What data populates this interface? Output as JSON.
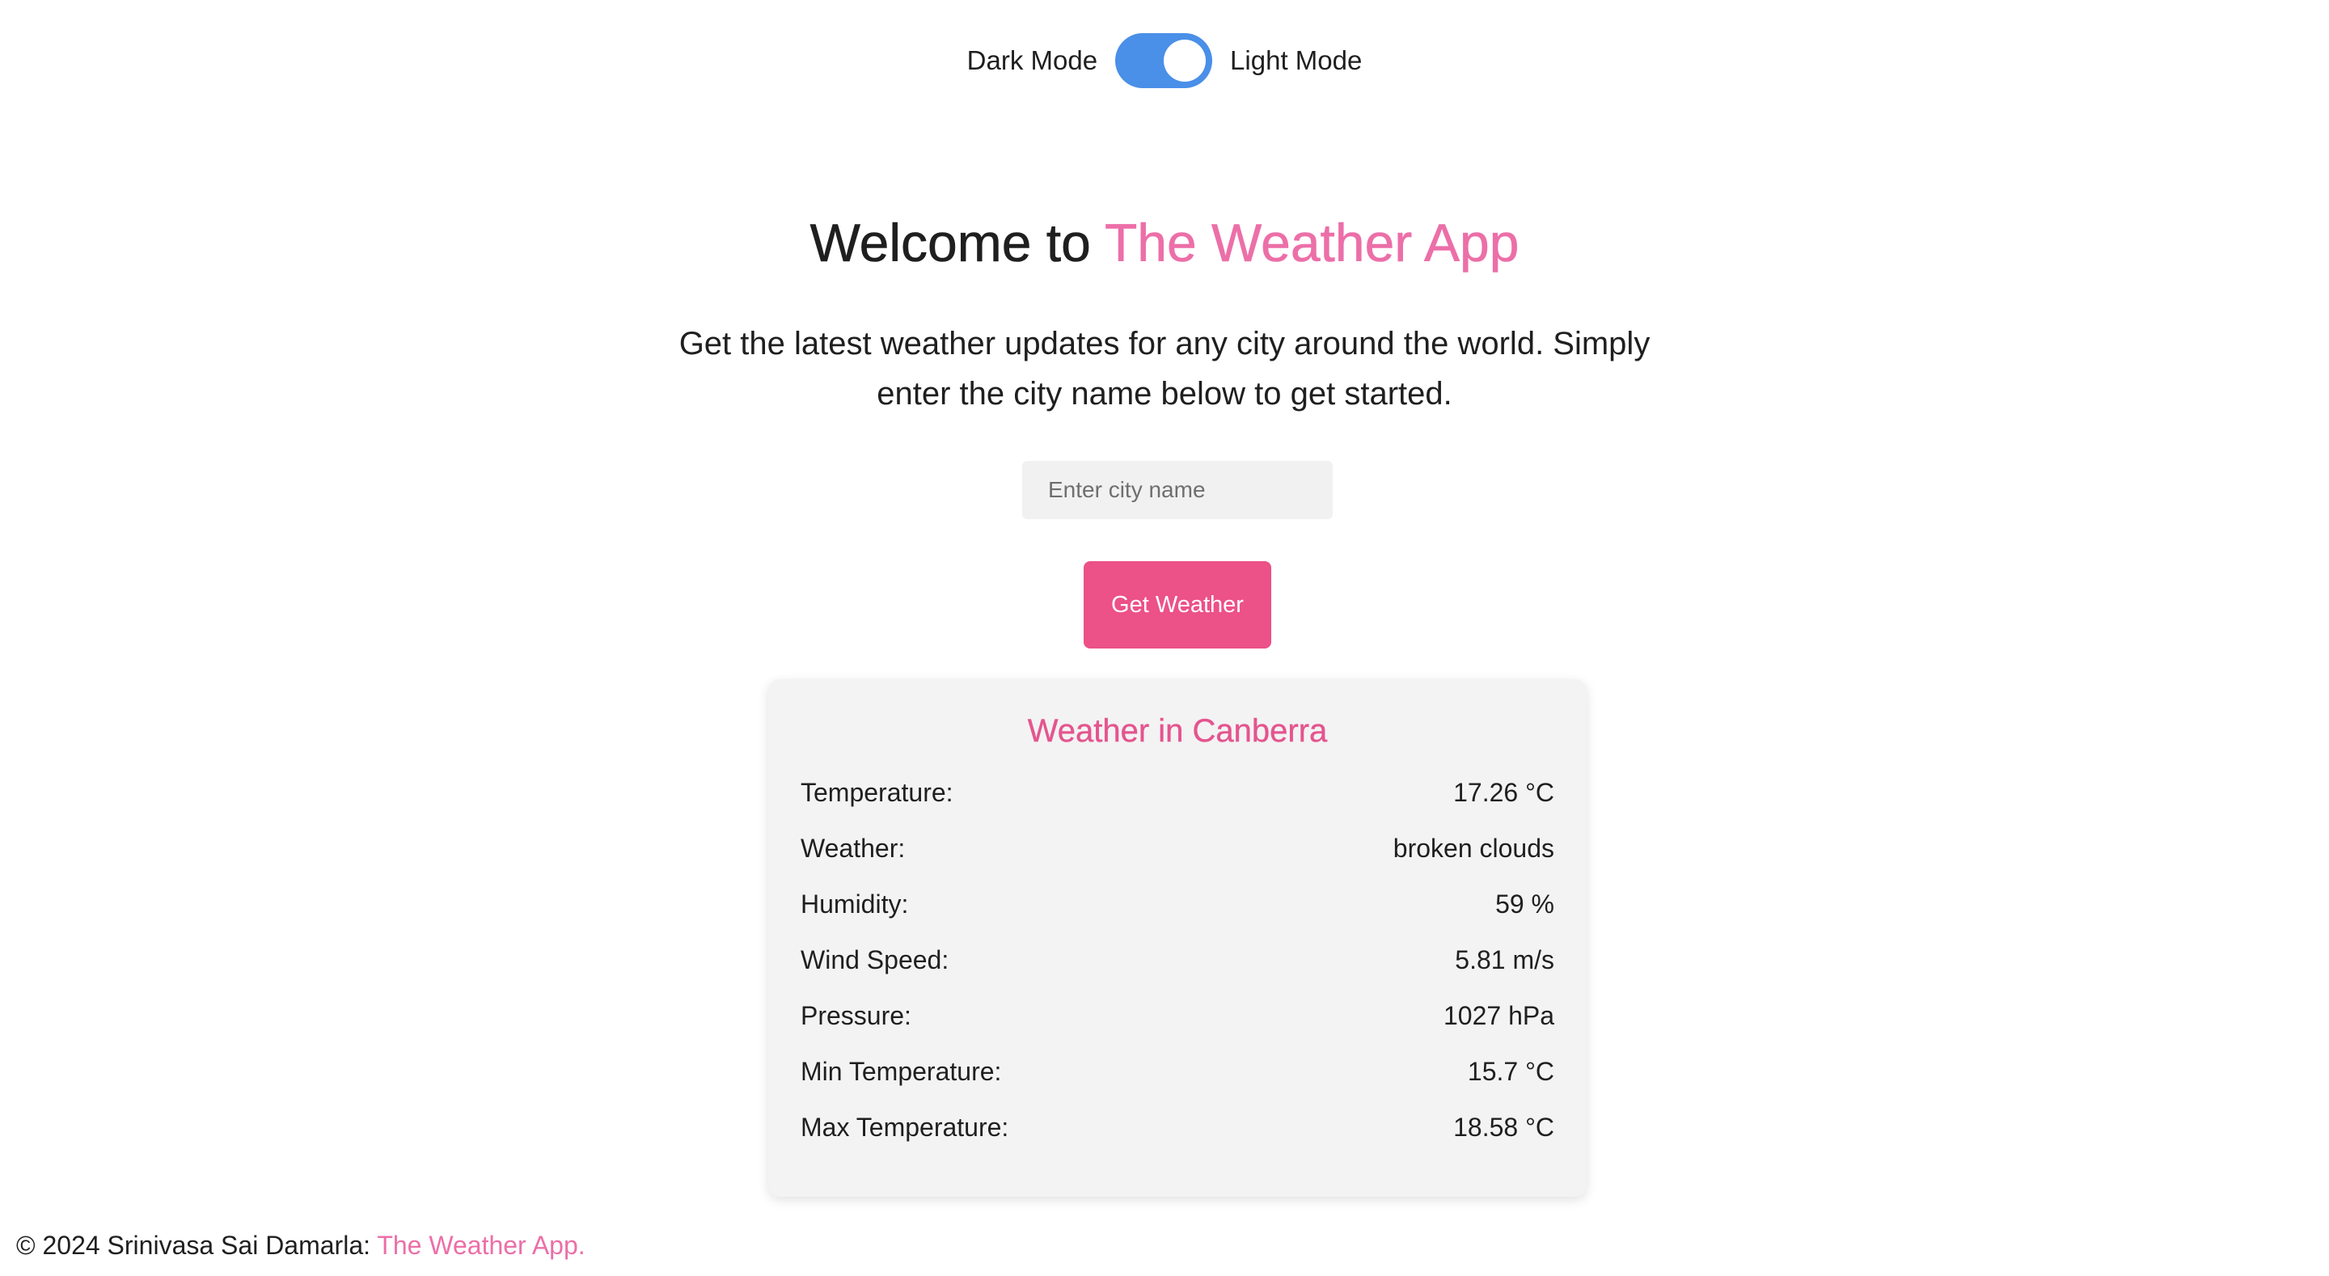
{
  "theme_toggle": {
    "dark_label": "Dark Mode",
    "light_label": "Light Mode",
    "state": "light",
    "track_color": "#4a8fe8"
  },
  "hero": {
    "title_prefix": "Welcome to ",
    "title_accent": "The Weather App",
    "description": "Get the latest weather updates for any city around the world. Simply enter the city name below to get started."
  },
  "search": {
    "placeholder": "Enter city name",
    "value": "",
    "button_label": "Get Weather"
  },
  "weather": {
    "title": "Weather in Canberra",
    "rows": [
      {
        "label": "Temperature:",
        "value": "17.26 °C"
      },
      {
        "label": "Weather:",
        "value": "broken clouds"
      },
      {
        "label": "Humidity:",
        "value": "59 %"
      },
      {
        "label": "Wind Speed:",
        "value": "5.81 m/s"
      },
      {
        "label": "Pressure:",
        "value": "1027 hPa"
      },
      {
        "label": "Min Temperature:",
        "value": "15.7 °C"
      },
      {
        "label": "Max Temperature:",
        "value": "18.58 °C"
      }
    ]
  },
  "footer": {
    "text": "© 2024 Srinivasa Sai Damarla: ",
    "link_label": "The Weather App."
  },
  "colors": {
    "accent_pink": "#ec6fa8",
    "button_pink": "#ec5187",
    "toggle_blue": "#4a8fe8",
    "card_bg": "#f3f3f3"
  }
}
